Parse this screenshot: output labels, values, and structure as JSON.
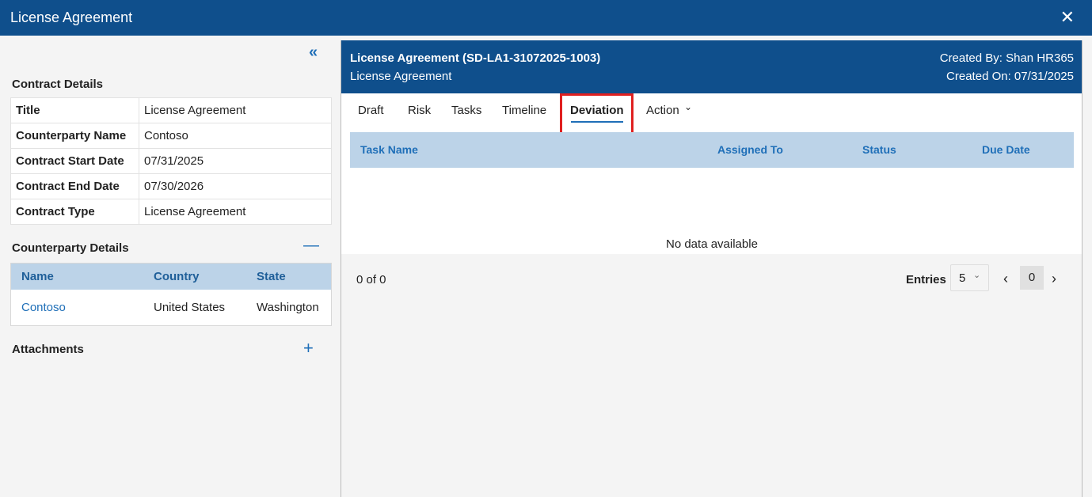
{
  "window": {
    "title": "License Agreement",
    "close": "✕"
  },
  "left": {
    "collapse": "«",
    "contract_details_title": "Contract Details",
    "contract_details": [
      {
        "k": "Title",
        "v": "License Agreement"
      },
      {
        "k": "Counterparty Name",
        "v": "Contoso"
      },
      {
        "k": "Contract Start Date",
        "v": "07/31/2025"
      },
      {
        "k": "Contract End Date",
        "v": "07/30/2026"
      },
      {
        "k": "Contract Type",
        "v": "License Agreement"
      }
    ],
    "counterparty_title": "Counterparty Details",
    "counterparty_headers": [
      "Name",
      "Country",
      "State"
    ],
    "counterparty_row": [
      "Contoso",
      "United States",
      "Washington"
    ],
    "attachments_title": "Attachments"
  },
  "header": {
    "title": "License Agreement (SD-LA1-31072025-1003)",
    "subtitle": "License Agreement",
    "created_by": "Created By: Shan HR365",
    "created_on": "Created On: 07/31/2025"
  },
  "tabs": [
    "Draft",
    "Risk",
    "Tasks",
    "Timeline",
    "Deviation",
    "Action"
  ],
  "table": {
    "headers": [
      "Task Name",
      "Assigned To",
      "Status",
      "Due Date"
    ],
    "empty": "No data available",
    "count": "0 of 0",
    "entries_label": "Entries",
    "entries_value": "5",
    "page": "0"
  }
}
